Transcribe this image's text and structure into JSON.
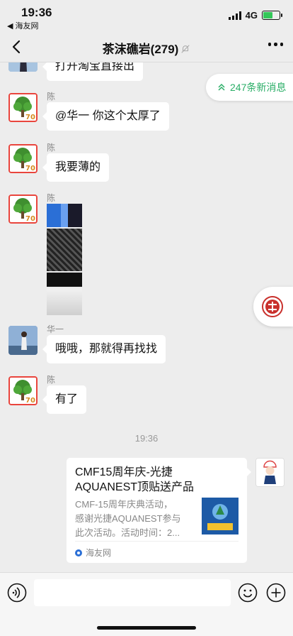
{
  "status_bar": {
    "time": "19:36",
    "back_app": "◀ 海友网",
    "network": "4G",
    "battery_color": "#34c759"
  },
  "nav": {
    "title": "茶沫礁岩(279)",
    "back_icon": "chevron-left-icon",
    "mute_icon": "bell-slash-icon",
    "more_icon": "more-dots-icon"
  },
  "new_messages": {
    "label": "247条新消息",
    "accent": "#2aae67"
  },
  "messages": [
    {
      "sender": "",
      "text": "打开淘宝直接出"
    },
    {
      "sender": "陈",
      "text": "@华一 你这个太厚了"
    },
    {
      "sender": "陈",
      "text": "我要薄的"
    },
    {
      "sender": "陈",
      "text": ""
    },
    {
      "sender": "华一",
      "text": "哦哦，那就得再找找"
    },
    {
      "sender": "陈",
      "text": "有了"
    }
  ],
  "avatar_badge": "70",
  "timestamp": "19:36",
  "link_card": {
    "title_line1": "CMF15周年庆-光捷",
    "title_line2": "AQUANEST顶贴送产品",
    "desc_line1": "CMF-15周年庆典活动，",
    "desc_line2": "感谢光捷AQUANEST参与",
    "desc_line3": "此次活动。活动时间：2...",
    "source": "海友网"
  },
  "input_bar": {
    "voice_icon": "voice-icon",
    "emoji_icon": "emoji-icon",
    "plus_icon": "plus-icon"
  }
}
